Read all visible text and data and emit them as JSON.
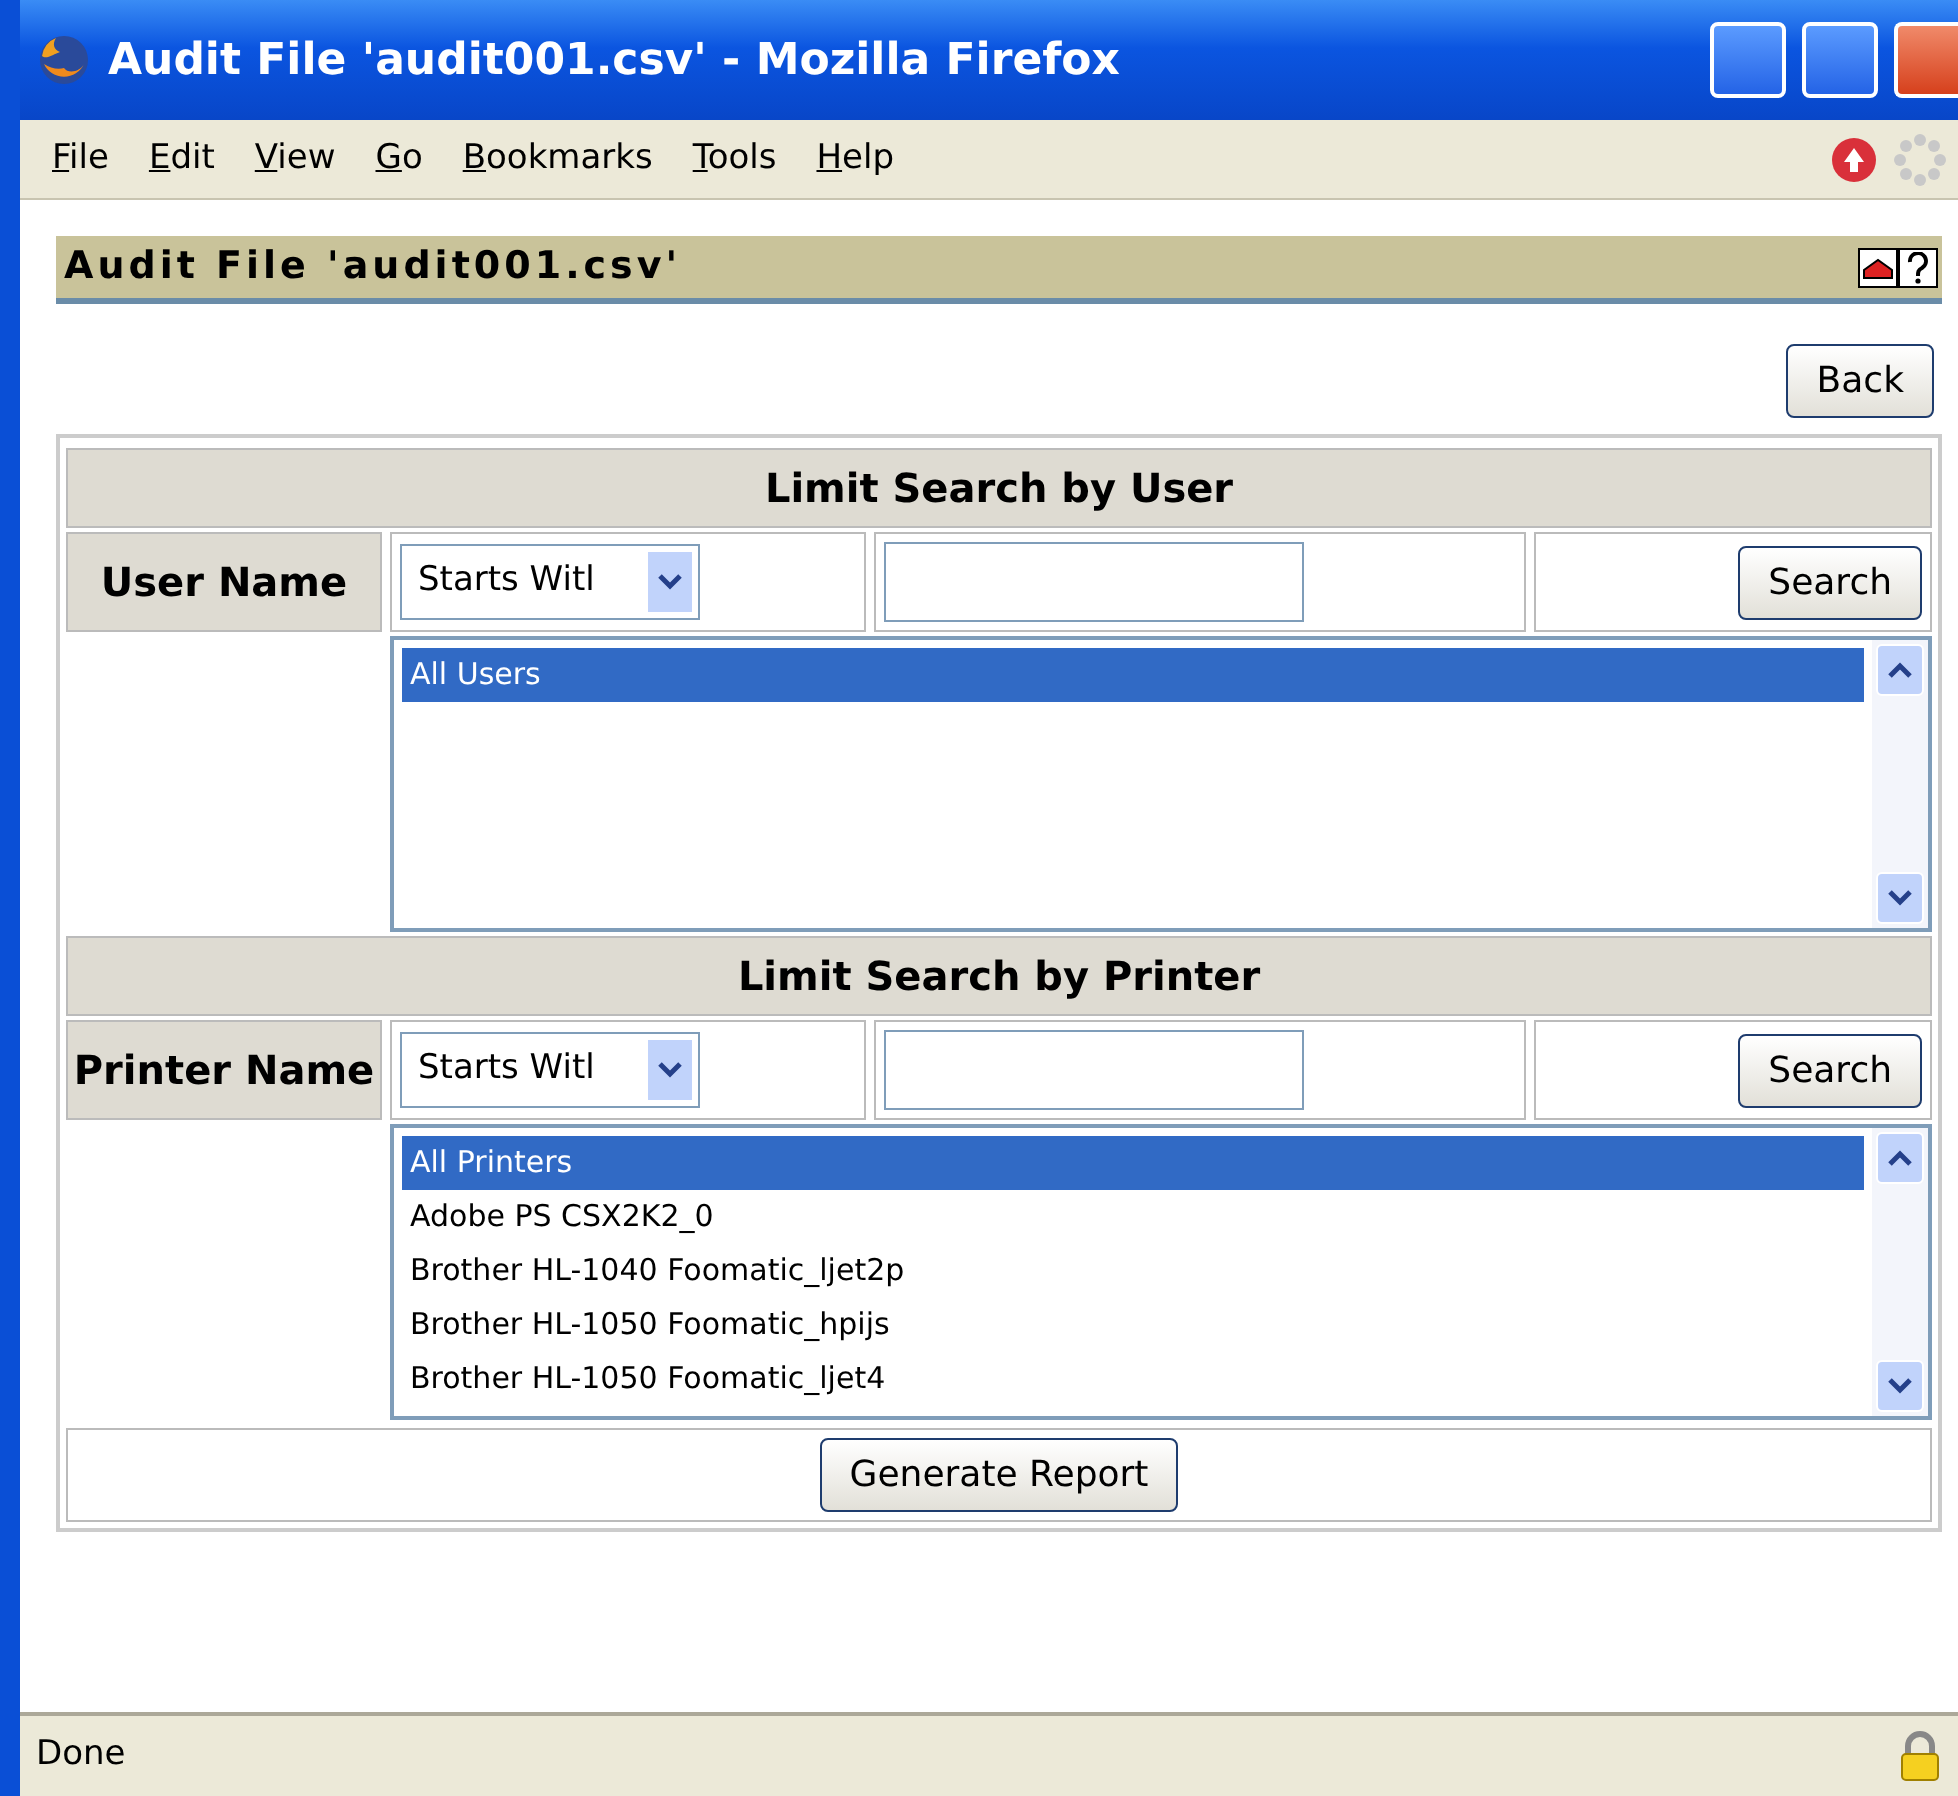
{
  "window": {
    "title": "Audit File 'audit001.csv' - Mozilla Firefox"
  },
  "menu": [
    "File",
    "Edit",
    "View",
    "Go",
    "Bookmarks",
    "Tools",
    "Help"
  ],
  "page_header": {
    "title": "Audit File 'audit001.csv'"
  },
  "back_button": "Back",
  "sections": [
    {
      "heading": "Limit Search by User",
      "label": "User Name",
      "match": "Starts Witl",
      "search_button": "Search",
      "options": [
        {
          "label": "All Users",
          "selected": true
        }
      ]
    },
    {
      "heading": "Limit Search by Printer",
      "label": "Printer Name",
      "match": "Starts Witl",
      "search_button": "Search",
      "options": [
        {
          "label": "All Printers",
          "selected": true
        },
        {
          "label": "Adobe PS CSX2K2_0",
          "selected": false
        },
        {
          "label": "Brother HL-1040 Foomatic_ljet2p",
          "selected": false
        },
        {
          "label": "Brother HL-1050 Foomatic_hpijs",
          "selected": false
        },
        {
          "label": "Brother HL-1050 Foomatic_ljet4",
          "selected": false
        }
      ]
    }
  ],
  "generate_button": "Generate Report",
  "status_bar": {
    "text": "Done"
  }
}
